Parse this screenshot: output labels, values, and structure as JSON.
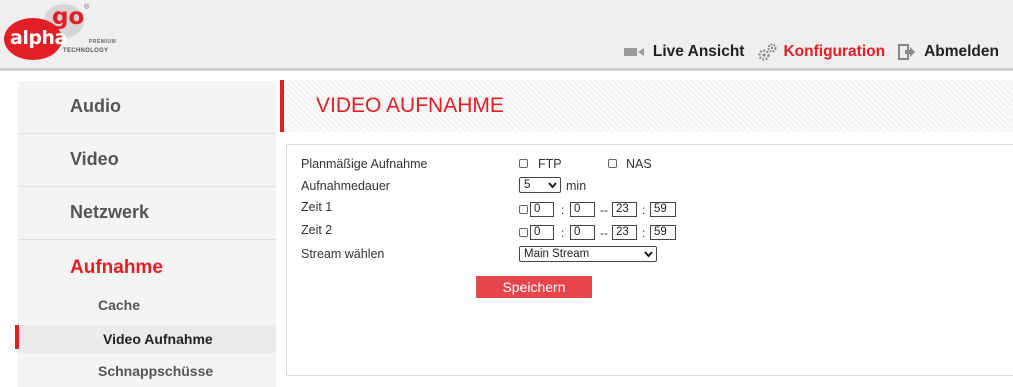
{
  "logo": {
    "brand_alpha": "alpha",
    "brand_go": "go",
    "registered": "®",
    "tagline_premium": "PREMIUM",
    "tagline_technology": "TECHNOLOGY",
    "accent_color": "#e31e24"
  },
  "topnav": {
    "live_view": "Live Ansicht",
    "configuration": "Konfiguration",
    "logout": "Abmelden",
    "active": "configuration"
  },
  "sidebar": {
    "items": [
      {
        "label": "Audio",
        "active": false
      },
      {
        "label": "Video",
        "active": false
      },
      {
        "label": "Netzwerk",
        "active": false
      },
      {
        "label": "Aufnahme",
        "active": true
      }
    ],
    "subitems": [
      {
        "label": "Cache",
        "active": false
      },
      {
        "label": "Video Aufnahme",
        "active": true
      },
      {
        "label": "Schnappschüsse",
        "active": false
      }
    ]
  },
  "page": {
    "title": "VIDEO AUFNAHME"
  },
  "form": {
    "scheduled_recording_label": "Planmäßige Aufnahme",
    "ftp_label": "FTP",
    "ftp_checked": false,
    "nas_label": "NAS",
    "nas_checked": false,
    "duration_label": "Aufnahmedauer",
    "duration_value": "5",
    "duration_unit": "min",
    "time1_label": "Zeit 1",
    "time1": {
      "enabled": false,
      "start_hour": "0",
      "start_min": "0",
      "end_hour": "23",
      "end_min": "59"
    },
    "time2_label": "Zeit 2",
    "time2": {
      "enabled": false,
      "start_hour": "0",
      "start_min": "0",
      "end_hour": "23",
      "end_min": "59"
    },
    "stream_label": "Stream wählen",
    "stream_value": "Main Stream",
    "colon": ":",
    "dash": "--",
    "save_label": "Speichern"
  }
}
